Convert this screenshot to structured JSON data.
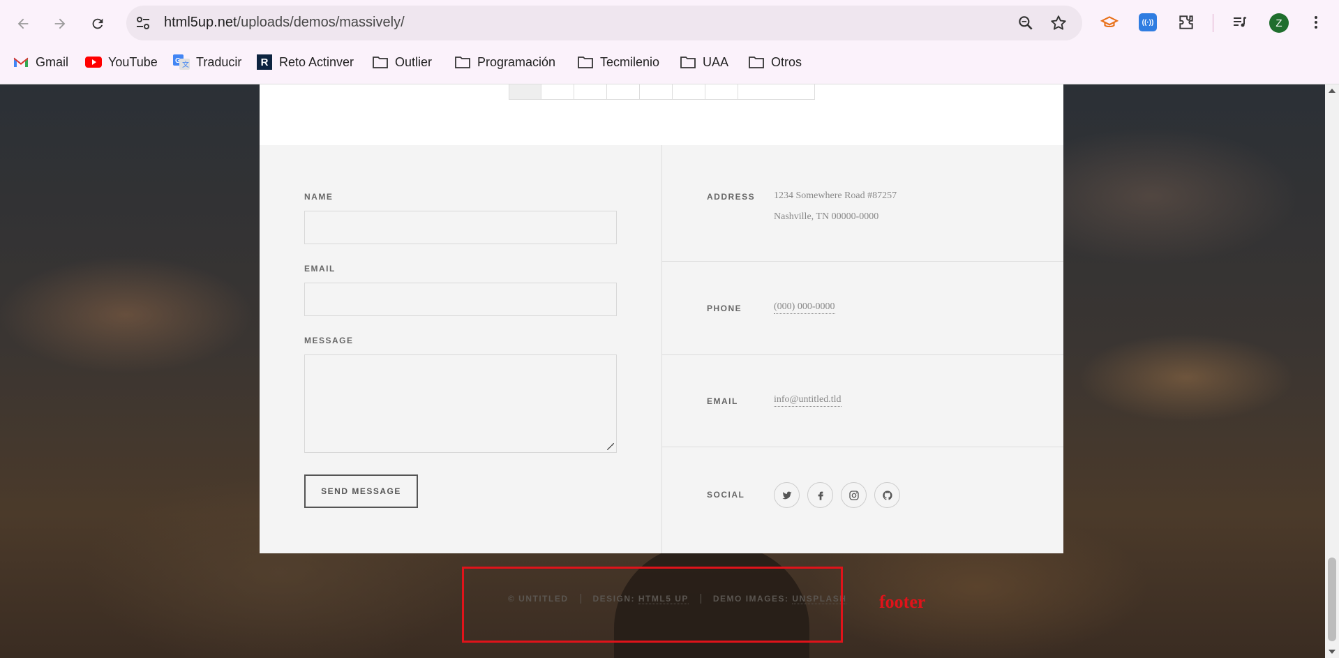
{
  "browser": {
    "url_host": "html5up.net",
    "url_path": "/uploads/demos/massively/",
    "avatar_letter": "Z",
    "bookmarks": [
      {
        "label": "Gmail",
        "icon": "gmail-icon"
      },
      {
        "label": "YouTube",
        "icon": "youtube-icon"
      },
      {
        "label": "Traducir",
        "icon": "translate-icon"
      },
      {
        "label": "Reto Actinver",
        "icon": "actinver-icon"
      },
      {
        "label": "Outlier",
        "icon": "folder-icon"
      },
      {
        "label": "Programación",
        "icon": "folder-icon"
      },
      {
        "label": "Tecmilenio",
        "icon": "folder-icon"
      },
      {
        "label": "UAA",
        "icon": "folder-icon"
      },
      {
        "label": "Otros",
        "icon": "folder-icon"
      }
    ]
  },
  "form": {
    "name_label": "Name",
    "email_label": "Email",
    "message_label": "Message",
    "name_value": "",
    "email_value": "",
    "message_value": "",
    "submit_label": "Send Message"
  },
  "contact": {
    "address_label": "Address",
    "address_line1": "1234 Somewhere Road #87257",
    "address_line2": "Nashville, TN 00000-0000",
    "phone_label": "Phone",
    "phone_value": "(000) 000-0000",
    "email_label": "Email",
    "email_value": "info@untitled.tld",
    "social_label": "Social",
    "social_icons": [
      "twitter-icon",
      "facebook-icon",
      "instagram-icon",
      "github-icon"
    ]
  },
  "copyright": {
    "owner": "© Untitled",
    "design_prefix": "Design:",
    "design_link": "HTML5 UP",
    "images_prefix": "Demo Images:",
    "images_link": "Unsplash"
  },
  "annotation": {
    "label": "footer",
    "color": "#e0131a"
  }
}
